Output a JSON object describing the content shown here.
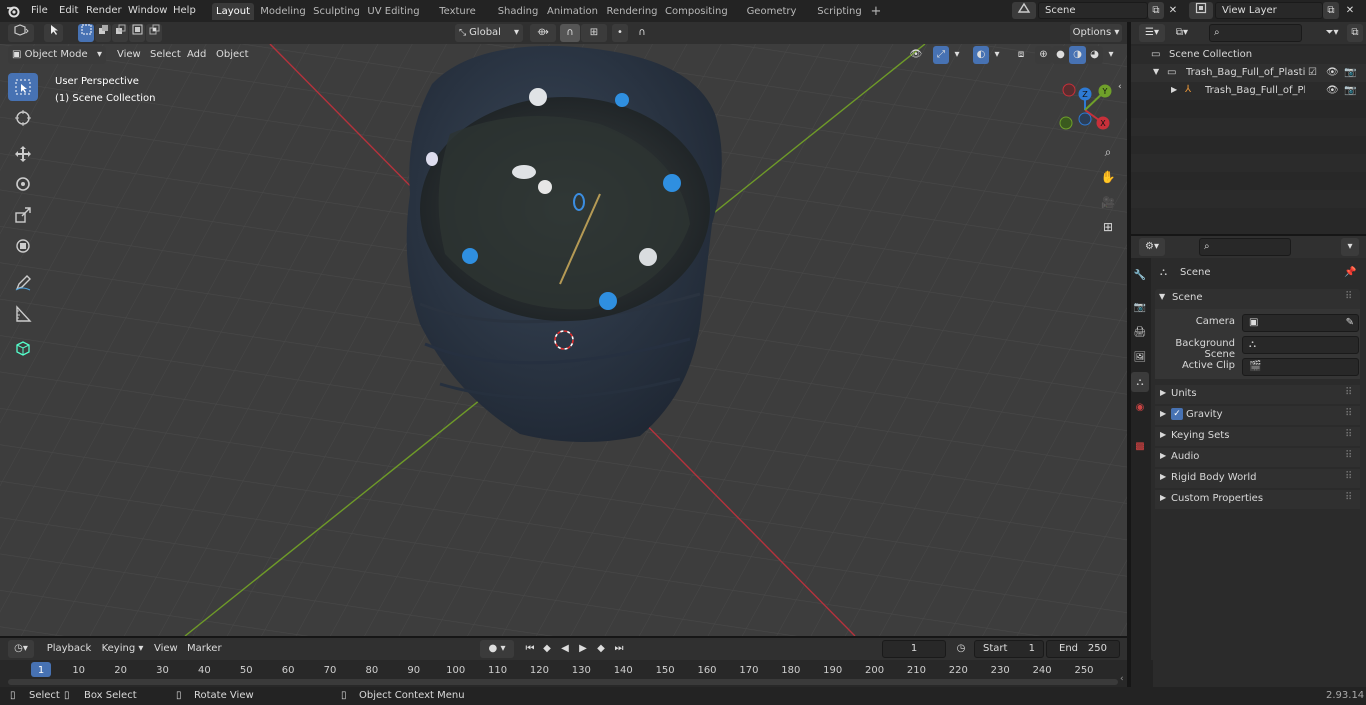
{
  "app": {
    "version": "2.93.14"
  },
  "menus": [
    "File",
    "Edit",
    "Render",
    "Window",
    "Help"
  ],
  "workspaces": [
    "Layout",
    "Modeling",
    "Sculpting",
    "UV Editing",
    "Texture Paint",
    "Shading",
    "Animation",
    "Rendering",
    "Compositing",
    "Geometry Nodes",
    "Scripting"
  ],
  "active_workspace": "Layout",
  "scene_field": "Scene",
  "viewlayer_field": "View Layer",
  "viewport": {
    "mode": "Object Mode",
    "menus": [
      "View",
      "Select",
      "Add",
      "Object"
    ],
    "orientation": "Global",
    "options": "Options",
    "overlay_title": "User Perspective",
    "overlay_subtitle": "(1) Scene Collection",
    "gizmo": {
      "z": "Z",
      "y": "Y",
      "x": "X"
    }
  },
  "outliner": {
    "root": "Scene Collection",
    "items": [
      {
        "label": "Trash_Bag_Full_of_Plastic_Bo"
      },
      {
        "label": "Trash_Bag_Full_of_Plastic"
      }
    ]
  },
  "properties": {
    "context": "Scene",
    "panel": "Scene",
    "fields": [
      {
        "label": "Camera"
      },
      {
        "label": "Background Scene"
      },
      {
        "label": "Active Clip"
      }
    ],
    "sections": [
      "Units",
      "Gravity",
      "Keying Sets",
      "Audio",
      "Rigid Body World",
      "Custom Properties"
    ],
    "gravity_checked": true
  },
  "timeline": {
    "menus": [
      "Playback",
      "Keying",
      "View",
      "Marker"
    ],
    "current_frame": "1",
    "start_label": "Start",
    "start": "1",
    "end_label": "End",
    "end": "250",
    "ticks": [
      "1",
      "10",
      "20",
      "30",
      "40",
      "50",
      "60",
      "70",
      "80",
      "90",
      "100",
      "110",
      "120",
      "130",
      "140",
      "150",
      "160",
      "170",
      "180",
      "190",
      "200",
      "210",
      "220",
      "230",
      "240",
      "250"
    ]
  },
  "statusbar": {
    "items": [
      "Select",
      "Box Select",
      "Rotate View",
      "Object Context Menu"
    ]
  },
  "colors": {
    "accent": "#4772b3",
    "x_axis": "#c8303a",
    "y_axis": "#6fa02a",
    "z_axis": "#2e7ad4"
  }
}
